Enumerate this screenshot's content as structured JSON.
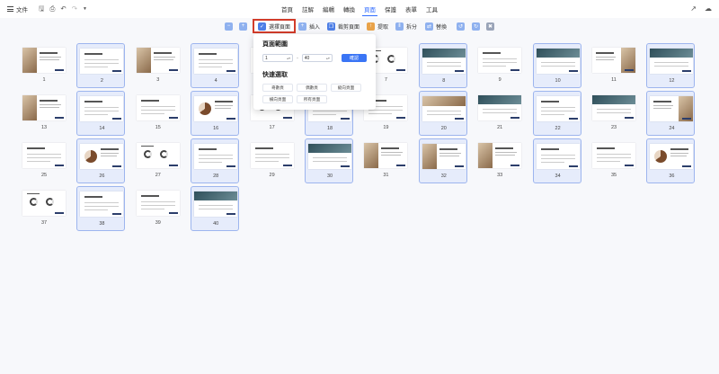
{
  "menu": {
    "file_label": "文件",
    "tabs": [
      "首頁",
      "註解",
      "編輯",
      "轉換",
      "頁面",
      "保護",
      "表單",
      "工具"
    ],
    "active_tab": "頁面"
  },
  "toolbar": {
    "select_pages": "選擇頁面",
    "insert": "插入",
    "crop_page": "裁剪頁面",
    "extract": "提取",
    "split": "拆分",
    "replace": "替換"
  },
  "popup": {
    "range_title": "頁面範圍",
    "from_value": "1",
    "to_value": "40",
    "range_separator": "-",
    "confirm": "確認",
    "quick_title": "快速選取",
    "quick_options": [
      "奇數頁",
      "偶數頁",
      "縱向頁面",
      "橫向頁面",
      "所有頁面"
    ]
  },
  "pages": {
    "total": 40,
    "selected": [
      2,
      4,
      8,
      10,
      12,
      14,
      16,
      18,
      20,
      22,
      24,
      26,
      28,
      30,
      32,
      34,
      36,
      38,
      40
    ],
    "numbers": [
      "1",
      "2",
      "3",
      "4",
      "5",
      "6",
      "7",
      "8",
      "9",
      "10",
      "11",
      "12",
      "13",
      "14",
      "15",
      "16",
      "17",
      "18",
      "19",
      "20",
      "21",
      "22",
      "23",
      "24",
      "25",
      "26",
      "27",
      "28",
      "29",
      "30",
      "31",
      "32",
      "33",
      "34",
      "35",
      "36",
      "37",
      "38",
      "39",
      "40"
    ]
  },
  "colors": {
    "accent": "#2f6bff",
    "selected_fill": "#e6ecfb",
    "highlight_border": "#d23c2a",
    "confirm": "#3a75f5"
  }
}
